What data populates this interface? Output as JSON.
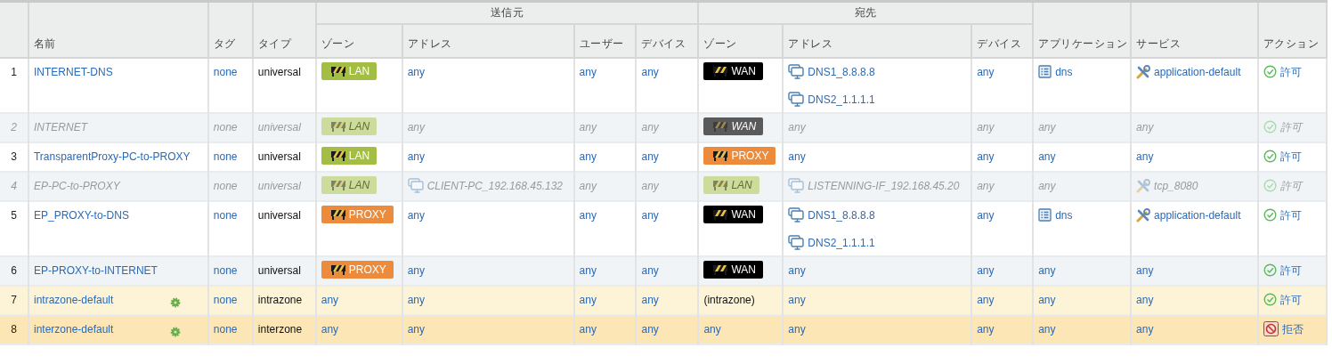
{
  "table": {
    "columns": [
      {
        "kind": "number"
      },
      {
        "label": "名前"
      },
      {
        "label": "タグ"
      },
      {
        "label": "タイプ"
      },
      {
        "group": "送信元",
        "colspan": 4,
        "columns": [
          {
            "label": "ゾーン"
          },
          {
            "label": "アドレス"
          },
          {
            "label": "ユーザー"
          },
          {
            "label": "デバイス"
          }
        ]
      },
      {
        "group": "宛先",
        "colspan": 3,
        "columns": [
          {
            "label": "ゾーン"
          },
          {
            "label": "アドレス"
          },
          {
            "label": "デバイス"
          }
        ]
      },
      {
        "label": "アプリケーション"
      },
      {
        "label": "サービス"
      },
      {
        "label": "アクション"
      }
    ],
    "rows": [
      {
        "kind": "rule",
        "predefined": false,
        "disabled": false,
        "selected": false,
        "cells": [
          [
            {
              "kind": "number",
              "text": "1"
            }
          ],
          [
            {
              "kind": "name",
              "text": "INTERNET-DNS"
            }
          ],
          [
            {
              "kind": "link",
              "text": "none"
            }
          ],
          [
            {
              "kind": "text",
              "text": "universal"
            }
          ],
          [
            {
              "kind": "zone",
              "text": "LAN",
              "color": "#a3bd45"
            }
          ],
          [
            {
              "kind": "link",
              "text": "any"
            }
          ],
          [
            {
              "kind": "link",
              "text": "any"
            }
          ],
          [
            {
              "kind": "link",
              "text": "any"
            }
          ],
          [
            {
              "kind": "zone",
              "text": "WAN",
              "color": "#000000"
            }
          ],
          [
            {
              "kind": "address",
              "text": "DNS1_8.8.8.8"
            },
            {
              "kind": "address",
              "text": "DNS2_1.1.1.1"
            }
          ],
          [
            {
              "kind": "link",
              "text": "any"
            }
          ],
          [
            {
              "kind": "application",
              "text": "dns"
            }
          ],
          [
            {
              "kind": "service",
              "text": "application-default"
            }
          ],
          [
            {
              "kind": "allow",
              "text": "許可"
            }
          ]
        ]
      },
      {
        "kind": "rule",
        "predefined": false,
        "disabled": true,
        "selected": false,
        "cells": [
          [
            {
              "kind": "number",
              "text": "2"
            }
          ],
          [
            {
              "kind": "name",
              "text": "INTERNET"
            }
          ],
          [
            {
              "kind": "link",
              "text": "none"
            }
          ],
          [
            {
              "kind": "text",
              "text": "universal"
            }
          ],
          [
            {
              "kind": "zone",
              "text": "LAN",
              "color": "#cddc9d"
            }
          ],
          [
            {
              "kind": "link",
              "text": "any"
            }
          ],
          [
            {
              "kind": "link",
              "text": "any"
            }
          ],
          [
            {
              "kind": "link",
              "text": "any"
            }
          ],
          [
            {
              "kind": "zone",
              "text": "WAN",
              "color": "#5a5a5a"
            }
          ],
          [
            {
              "kind": "link",
              "text": "any"
            }
          ],
          [
            {
              "kind": "link",
              "text": "any"
            }
          ],
          [
            {
              "kind": "link",
              "text": "any"
            }
          ],
          [
            {
              "kind": "link",
              "text": "any"
            }
          ],
          [
            {
              "kind": "allow",
              "text": "許可"
            }
          ]
        ]
      },
      {
        "kind": "rule",
        "predefined": false,
        "disabled": false,
        "selected": false,
        "cells": [
          [
            {
              "kind": "number",
              "text": "3"
            }
          ],
          [
            {
              "kind": "name",
              "text": "TransparentProxy-PC-to-PROXY"
            }
          ],
          [
            {
              "kind": "link",
              "text": "none"
            }
          ],
          [
            {
              "kind": "text",
              "text": "universal"
            }
          ],
          [
            {
              "kind": "zone",
              "text": "LAN",
              "color": "#a3bd45"
            }
          ],
          [
            {
              "kind": "link",
              "text": "any"
            }
          ],
          [
            {
              "kind": "link",
              "text": "any"
            }
          ],
          [
            {
              "kind": "link",
              "text": "any"
            }
          ],
          [
            {
              "kind": "zone",
              "text": "PROXY",
              "color": "#ec8b3b"
            }
          ],
          [
            {
              "kind": "link",
              "text": "any"
            }
          ],
          [
            {
              "kind": "link",
              "text": "any"
            }
          ],
          [
            {
              "kind": "link",
              "text": "any"
            }
          ],
          [
            {
              "kind": "link",
              "text": "any"
            }
          ],
          [
            {
              "kind": "allow",
              "text": "許可"
            }
          ]
        ]
      },
      {
        "kind": "rule",
        "predefined": false,
        "disabled": true,
        "selected": false,
        "cells": [
          [
            {
              "kind": "number",
              "text": "4"
            }
          ],
          [
            {
              "kind": "name",
              "text": "EP-PC-to-PROXY"
            }
          ],
          [
            {
              "kind": "link",
              "text": "none"
            }
          ],
          [
            {
              "kind": "text",
              "text": "universal"
            }
          ],
          [
            {
              "kind": "zone",
              "text": "LAN",
              "color": "#cddc9d"
            }
          ],
          [
            {
              "kind": "address",
              "text": "CLIENT-PC_192.168.45.132"
            }
          ],
          [
            {
              "kind": "link",
              "text": "any"
            }
          ],
          [
            {
              "kind": "link",
              "text": "any"
            }
          ],
          [
            {
              "kind": "zone",
              "text": "LAN",
              "color": "#cddc9d"
            }
          ],
          [
            {
              "kind": "address",
              "text": "LISTENNING-IF_192.168.45.20"
            }
          ],
          [
            {
              "kind": "link",
              "text": "any"
            }
          ],
          [
            {
              "kind": "link",
              "text": "any"
            }
          ],
          [
            {
              "kind": "service",
              "text": "tcp_8080"
            }
          ],
          [
            {
              "kind": "allow",
              "text": "許可"
            }
          ]
        ]
      },
      {
        "kind": "rule",
        "predefined": false,
        "disabled": false,
        "selected": false,
        "cells": [
          [
            {
              "kind": "number",
              "text": "5"
            }
          ],
          [
            {
              "kind": "name",
              "text": "EP_PROXY-to-DNS"
            }
          ],
          [
            {
              "kind": "link",
              "text": "none"
            }
          ],
          [
            {
              "kind": "text",
              "text": "universal"
            }
          ],
          [
            {
              "kind": "zone",
              "text": "PROXY",
              "color": "#ec8b3b"
            }
          ],
          [
            {
              "kind": "link",
              "text": "any"
            }
          ],
          [
            {
              "kind": "link",
              "text": "any"
            }
          ],
          [
            {
              "kind": "link",
              "text": "any"
            }
          ],
          [
            {
              "kind": "zone",
              "text": "WAN",
              "color": "#000000"
            }
          ],
          [
            {
              "kind": "address",
              "text": "DNS1_8.8.8.8"
            },
            {
              "kind": "address",
              "text": "DNS2_1.1.1.1"
            }
          ],
          [
            {
              "kind": "link",
              "text": "any"
            }
          ],
          [
            {
              "kind": "application",
              "text": "dns"
            }
          ],
          [
            {
              "kind": "service",
              "text": "application-default"
            }
          ],
          [
            {
              "kind": "allow",
              "text": "許可"
            }
          ]
        ]
      },
      {
        "kind": "rule",
        "predefined": false,
        "disabled": false,
        "selected": false,
        "cells": [
          [
            {
              "kind": "number",
              "text": "6"
            }
          ],
          [
            {
              "kind": "name",
              "text": "EP-PROXY-to-INTERNET"
            }
          ],
          [
            {
              "kind": "link",
              "text": "none"
            }
          ],
          [
            {
              "kind": "text",
              "text": "universal"
            }
          ],
          [
            {
              "kind": "zone",
              "text": "PROXY",
              "color": "#ec8b3b"
            }
          ],
          [
            {
              "kind": "link",
              "text": "any"
            }
          ],
          [
            {
              "kind": "link",
              "text": "any"
            }
          ],
          [
            {
              "kind": "link",
              "text": "any"
            }
          ],
          [
            {
              "kind": "zone",
              "text": "WAN",
              "color": "#000000"
            }
          ],
          [
            {
              "kind": "link",
              "text": "any"
            }
          ],
          [
            {
              "kind": "link",
              "text": "any"
            }
          ],
          [
            {
              "kind": "link",
              "text": "any"
            }
          ],
          [
            {
              "kind": "link",
              "text": "any"
            }
          ],
          [
            {
              "kind": "allow",
              "text": "許可"
            }
          ]
        ]
      },
      {
        "kind": "default",
        "predefined": true,
        "disabled": false,
        "selected": false,
        "cells": [
          [
            {
              "kind": "number",
              "text": "7"
            }
          ],
          [
            {
              "kind": "name",
              "text": "intrazone-default"
            }
          ],
          [
            {
              "kind": "link",
              "text": "none"
            }
          ],
          [
            {
              "kind": "text",
              "text": "intrazone"
            }
          ],
          [
            {
              "kind": "link",
              "text": "any"
            }
          ],
          [
            {
              "kind": "link",
              "text": "any"
            }
          ],
          [
            {
              "kind": "link",
              "text": "any"
            }
          ],
          [
            {
              "kind": "link",
              "text": "any"
            }
          ],
          [
            {
              "kind": "text",
              "text": "(intrazone)"
            }
          ],
          [
            {
              "kind": "link",
              "text": "any"
            }
          ],
          [
            {
              "kind": "link",
              "text": "any"
            }
          ],
          [
            {
              "kind": "link",
              "text": "any"
            }
          ],
          [
            {
              "kind": "link",
              "text": "any"
            }
          ],
          [
            {
              "kind": "allow",
              "text": "許可"
            }
          ]
        ]
      },
      {
        "kind": "default",
        "predefined": true,
        "disabled": false,
        "selected": true,
        "cells": [
          [
            {
              "kind": "number",
              "text": "8"
            }
          ],
          [
            {
              "kind": "name",
              "text": "interzone-default"
            }
          ],
          [
            {
              "kind": "link",
              "text": "none"
            }
          ],
          [
            {
              "kind": "text",
              "text": "interzone"
            }
          ],
          [
            {
              "kind": "link",
              "text": "any"
            }
          ],
          [
            {
              "kind": "link",
              "text": "any"
            }
          ],
          [
            {
              "kind": "link",
              "text": "any"
            }
          ],
          [
            {
              "kind": "link",
              "text": "any"
            }
          ],
          [
            {
              "kind": "link",
              "text": "any"
            }
          ],
          [
            {
              "kind": "link",
              "text": "any"
            }
          ],
          [
            {
              "kind": "link",
              "text": "any"
            }
          ],
          [
            {
              "kind": "link",
              "text": "any"
            }
          ],
          [
            {
              "kind": "link",
              "text": "any"
            }
          ],
          [
            {
              "kind": "deny",
              "text": "拒否"
            }
          ]
        ]
      }
    ]
  }
}
